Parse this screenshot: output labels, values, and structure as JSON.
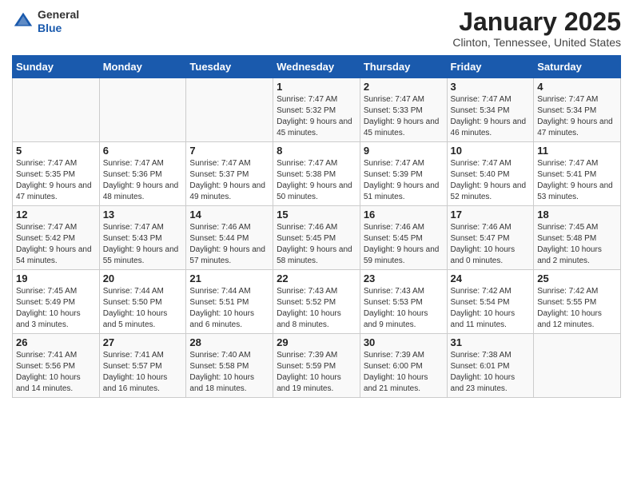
{
  "header": {
    "logo_line1": "General",
    "logo_line2": "Blue",
    "month": "January 2025",
    "location": "Clinton, Tennessee, United States"
  },
  "days_of_week": [
    "Sunday",
    "Monday",
    "Tuesday",
    "Wednesday",
    "Thursday",
    "Friday",
    "Saturday"
  ],
  "weeks": [
    [
      {
        "num": "",
        "sunrise": "",
        "sunset": "",
        "daylight": ""
      },
      {
        "num": "",
        "sunrise": "",
        "sunset": "",
        "daylight": ""
      },
      {
        "num": "",
        "sunrise": "",
        "sunset": "",
        "daylight": ""
      },
      {
        "num": "1",
        "sunrise": "Sunrise: 7:47 AM",
        "sunset": "Sunset: 5:32 PM",
        "daylight": "Daylight: 9 hours and 45 minutes."
      },
      {
        "num": "2",
        "sunrise": "Sunrise: 7:47 AM",
        "sunset": "Sunset: 5:33 PM",
        "daylight": "Daylight: 9 hours and 45 minutes."
      },
      {
        "num": "3",
        "sunrise": "Sunrise: 7:47 AM",
        "sunset": "Sunset: 5:34 PM",
        "daylight": "Daylight: 9 hours and 46 minutes."
      },
      {
        "num": "4",
        "sunrise": "Sunrise: 7:47 AM",
        "sunset": "Sunset: 5:34 PM",
        "daylight": "Daylight: 9 hours and 47 minutes."
      }
    ],
    [
      {
        "num": "5",
        "sunrise": "Sunrise: 7:47 AM",
        "sunset": "Sunset: 5:35 PM",
        "daylight": "Daylight: 9 hours and 47 minutes."
      },
      {
        "num": "6",
        "sunrise": "Sunrise: 7:47 AM",
        "sunset": "Sunset: 5:36 PM",
        "daylight": "Daylight: 9 hours and 48 minutes."
      },
      {
        "num": "7",
        "sunrise": "Sunrise: 7:47 AM",
        "sunset": "Sunset: 5:37 PM",
        "daylight": "Daylight: 9 hours and 49 minutes."
      },
      {
        "num": "8",
        "sunrise": "Sunrise: 7:47 AM",
        "sunset": "Sunset: 5:38 PM",
        "daylight": "Daylight: 9 hours and 50 minutes."
      },
      {
        "num": "9",
        "sunrise": "Sunrise: 7:47 AM",
        "sunset": "Sunset: 5:39 PM",
        "daylight": "Daylight: 9 hours and 51 minutes."
      },
      {
        "num": "10",
        "sunrise": "Sunrise: 7:47 AM",
        "sunset": "Sunset: 5:40 PM",
        "daylight": "Daylight: 9 hours and 52 minutes."
      },
      {
        "num": "11",
        "sunrise": "Sunrise: 7:47 AM",
        "sunset": "Sunset: 5:41 PM",
        "daylight": "Daylight: 9 hours and 53 minutes."
      }
    ],
    [
      {
        "num": "12",
        "sunrise": "Sunrise: 7:47 AM",
        "sunset": "Sunset: 5:42 PM",
        "daylight": "Daylight: 9 hours and 54 minutes."
      },
      {
        "num": "13",
        "sunrise": "Sunrise: 7:47 AM",
        "sunset": "Sunset: 5:43 PM",
        "daylight": "Daylight: 9 hours and 55 minutes."
      },
      {
        "num": "14",
        "sunrise": "Sunrise: 7:46 AM",
        "sunset": "Sunset: 5:44 PM",
        "daylight": "Daylight: 9 hours and 57 minutes."
      },
      {
        "num": "15",
        "sunrise": "Sunrise: 7:46 AM",
        "sunset": "Sunset: 5:45 PM",
        "daylight": "Daylight: 9 hours and 58 minutes."
      },
      {
        "num": "16",
        "sunrise": "Sunrise: 7:46 AM",
        "sunset": "Sunset: 5:45 PM",
        "daylight": "Daylight: 9 hours and 59 minutes."
      },
      {
        "num": "17",
        "sunrise": "Sunrise: 7:46 AM",
        "sunset": "Sunset: 5:47 PM",
        "daylight": "Daylight: 10 hours and 0 minutes."
      },
      {
        "num": "18",
        "sunrise": "Sunrise: 7:45 AM",
        "sunset": "Sunset: 5:48 PM",
        "daylight": "Daylight: 10 hours and 2 minutes."
      }
    ],
    [
      {
        "num": "19",
        "sunrise": "Sunrise: 7:45 AM",
        "sunset": "Sunset: 5:49 PM",
        "daylight": "Daylight: 10 hours and 3 minutes."
      },
      {
        "num": "20",
        "sunrise": "Sunrise: 7:44 AM",
        "sunset": "Sunset: 5:50 PM",
        "daylight": "Daylight: 10 hours and 5 minutes."
      },
      {
        "num": "21",
        "sunrise": "Sunrise: 7:44 AM",
        "sunset": "Sunset: 5:51 PM",
        "daylight": "Daylight: 10 hours and 6 minutes."
      },
      {
        "num": "22",
        "sunrise": "Sunrise: 7:43 AM",
        "sunset": "Sunset: 5:52 PM",
        "daylight": "Daylight: 10 hours and 8 minutes."
      },
      {
        "num": "23",
        "sunrise": "Sunrise: 7:43 AM",
        "sunset": "Sunset: 5:53 PM",
        "daylight": "Daylight: 10 hours and 9 minutes."
      },
      {
        "num": "24",
        "sunrise": "Sunrise: 7:42 AM",
        "sunset": "Sunset: 5:54 PM",
        "daylight": "Daylight: 10 hours and 11 minutes."
      },
      {
        "num": "25",
        "sunrise": "Sunrise: 7:42 AM",
        "sunset": "Sunset: 5:55 PM",
        "daylight": "Daylight: 10 hours and 12 minutes."
      }
    ],
    [
      {
        "num": "26",
        "sunrise": "Sunrise: 7:41 AM",
        "sunset": "Sunset: 5:56 PM",
        "daylight": "Daylight: 10 hours and 14 minutes."
      },
      {
        "num": "27",
        "sunrise": "Sunrise: 7:41 AM",
        "sunset": "Sunset: 5:57 PM",
        "daylight": "Daylight: 10 hours and 16 minutes."
      },
      {
        "num": "28",
        "sunrise": "Sunrise: 7:40 AM",
        "sunset": "Sunset: 5:58 PM",
        "daylight": "Daylight: 10 hours and 18 minutes."
      },
      {
        "num": "29",
        "sunrise": "Sunrise: 7:39 AM",
        "sunset": "Sunset: 5:59 PM",
        "daylight": "Daylight: 10 hours and 19 minutes."
      },
      {
        "num": "30",
        "sunrise": "Sunrise: 7:39 AM",
        "sunset": "Sunset: 6:00 PM",
        "daylight": "Daylight: 10 hours and 21 minutes."
      },
      {
        "num": "31",
        "sunrise": "Sunrise: 7:38 AM",
        "sunset": "Sunset: 6:01 PM",
        "daylight": "Daylight: 10 hours and 23 minutes."
      },
      {
        "num": "",
        "sunrise": "",
        "sunset": "",
        "daylight": ""
      }
    ]
  ]
}
